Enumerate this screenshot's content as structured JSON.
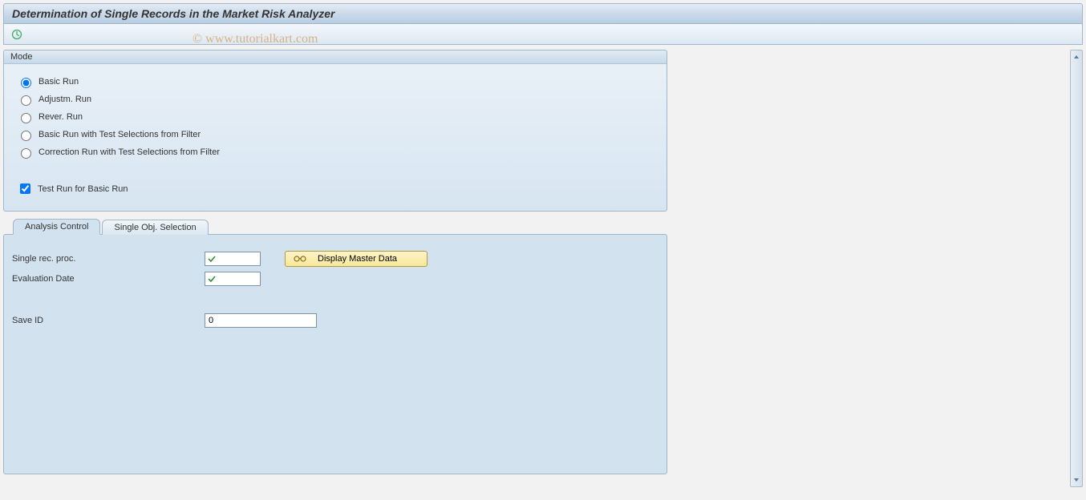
{
  "title": "Determination of Single Records in the Market Risk Analyzer",
  "watermark": "© www.tutorialkart.com",
  "mode": {
    "group_title": "Mode",
    "options": [
      {
        "label": "Basic Run",
        "selected": true
      },
      {
        "label": "Adjustm. Run",
        "selected": false
      },
      {
        "label": "Rever. Run",
        "selected": false
      },
      {
        "label": "Basic Run with Test Selections from Filter",
        "selected": false
      },
      {
        "label": "Correction Run with Test Selections from Filter",
        "selected": false
      }
    ],
    "test_run_label": "Test Run for Basic Run",
    "test_run_checked": true
  },
  "tabs": {
    "active": 0,
    "items": [
      {
        "label": "Analysis Control"
      },
      {
        "label": "Single Obj. Selection"
      }
    ]
  },
  "analysis_control": {
    "single_rec_label": "Single rec. proc.",
    "single_rec_value": "",
    "evaluation_date_label": "Evaluation Date",
    "evaluation_date_value": "",
    "save_id_label": "Save ID",
    "save_id_value": "0",
    "display_master_btn": "Display Master Data"
  }
}
